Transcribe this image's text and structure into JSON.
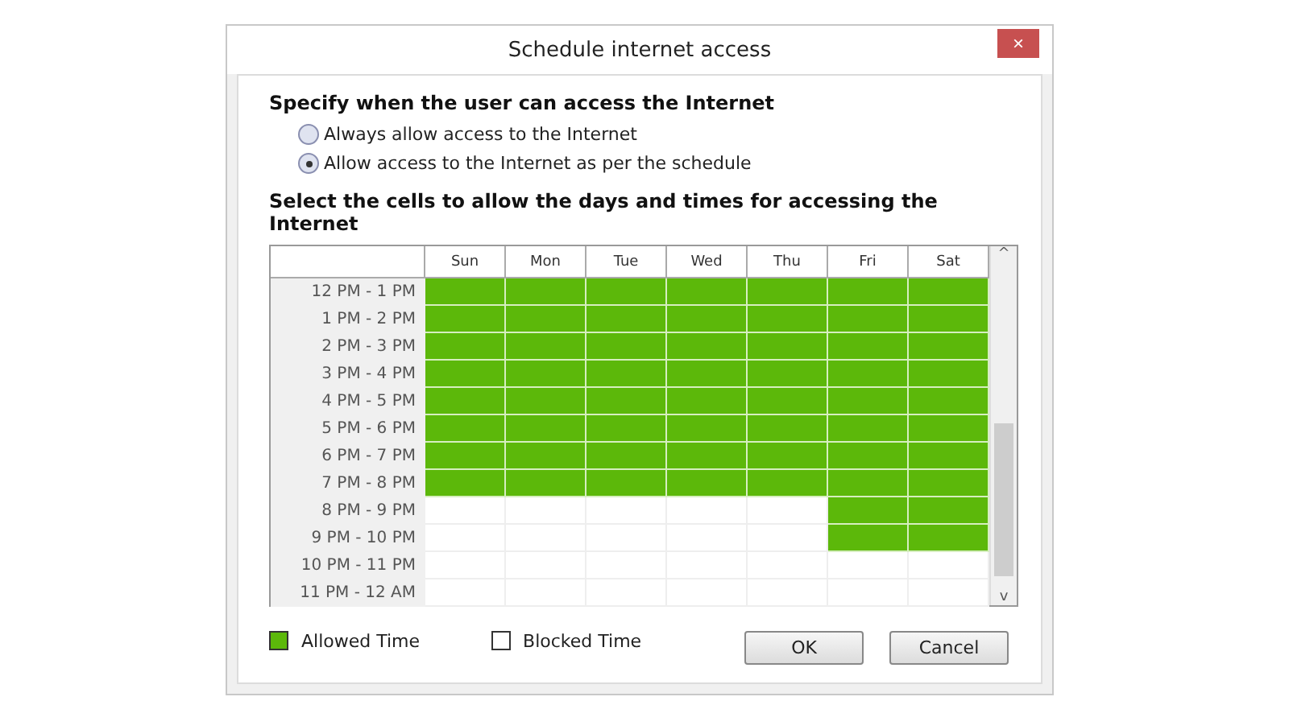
{
  "window": {
    "title": "Schedule internet access",
    "close": "×"
  },
  "heading": "Specify when the user can access the Internet",
  "options": [
    {
      "label": "Always allow access to the Internet",
      "selected": false
    },
    {
      "label": "Allow access to the Internet as per the schedule",
      "selected": true
    }
  ],
  "grid_heading": "Select the cells to allow the days and times for accessing the Internet",
  "days": [
    "Sun",
    "Mon",
    "Tue",
    "Wed",
    "Thu",
    "Fri",
    "Sat"
  ],
  "rows": [
    {
      "time": "12 PM - 1 PM",
      "allowed": [
        true,
        true,
        true,
        true,
        true,
        true,
        true
      ]
    },
    {
      "time": "1 PM - 2 PM",
      "allowed": [
        true,
        true,
        true,
        true,
        true,
        true,
        true
      ]
    },
    {
      "time": "2 PM - 3 PM",
      "allowed": [
        true,
        true,
        true,
        true,
        true,
        true,
        true
      ]
    },
    {
      "time": "3 PM - 4 PM",
      "allowed": [
        true,
        true,
        true,
        true,
        true,
        true,
        true
      ]
    },
    {
      "time": "4 PM - 5 PM",
      "allowed": [
        true,
        true,
        true,
        true,
        true,
        true,
        true
      ]
    },
    {
      "time": "5 PM - 6 PM",
      "allowed": [
        true,
        true,
        true,
        true,
        true,
        true,
        true
      ]
    },
    {
      "time": "6 PM - 7 PM",
      "allowed": [
        true,
        true,
        true,
        true,
        true,
        true,
        true
      ]
    },
    {
      "time": "7 PM - 8 PM",
      "allowed": [
        true,
        true,
        true,
        true,
        true,
        true,
        true
      ]
    },
    {
      "time": "8 PM - 9 PM",
      "allowed": [
        false,
        false,
        false,
        false,
        false,
        true,
        true
      ]
    },
    {
      "time": "9 PM - 10 PM",
      "allowed": [
        false,
        false,
        false,
        false,
        false,
        true,
        true
      ]
    },
    {
      "time": "10 PM - 11 PM",
      "allowed": [
        false,
        false,
        false,
        false,
        false,
        false,
        false
      ]
    },
    {
      "time": "11 PM - 12 AM",
      "allowed": [
        false,
        false,
        false,
        false,
        false,
        false,
        false
      ]
    }
  ],
  "scroll": {
    "up": "^",
    "down": "v"
  },
  "legend": [
    {
      "label": "Allowed Time",
      "kind": "allowed"
    },
    {
      "label": "Blocked Time",
      "kind": "blocked"
    }
  ],
  "buttons": [
    "OK",
    "Cancel"
  ]
}
